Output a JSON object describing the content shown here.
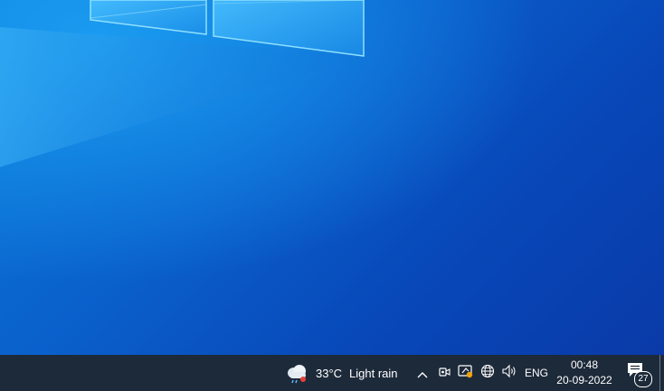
{
  "desktop": {
    "wallpaper": "windows-10-hero-wallpaper"
  },
  "taskbar": {
    "background_color": "#1d2a3a",
    "weather": {
      "icon": "cloud-rain-icon",
      "temperature": "33°C",
      "condition": "Light rain"
    },
    "tray": {
      "chevron_icon": "chevron-up-icon",
      "meet_icon": "meet-now-icon",
      "security_icon": "windows-security-icon",
      "network_icon": "globe-network-icon",
      "volume_icon": "speaker-volume-icon",
      "language": "ENG"
    },
    "clock": {
      "time": "00:48",
      "date": "20-09-2022"
    },
    "notifications": {
      "icon": "action-center-icon",
      "count": "27"
    }
  }
}
